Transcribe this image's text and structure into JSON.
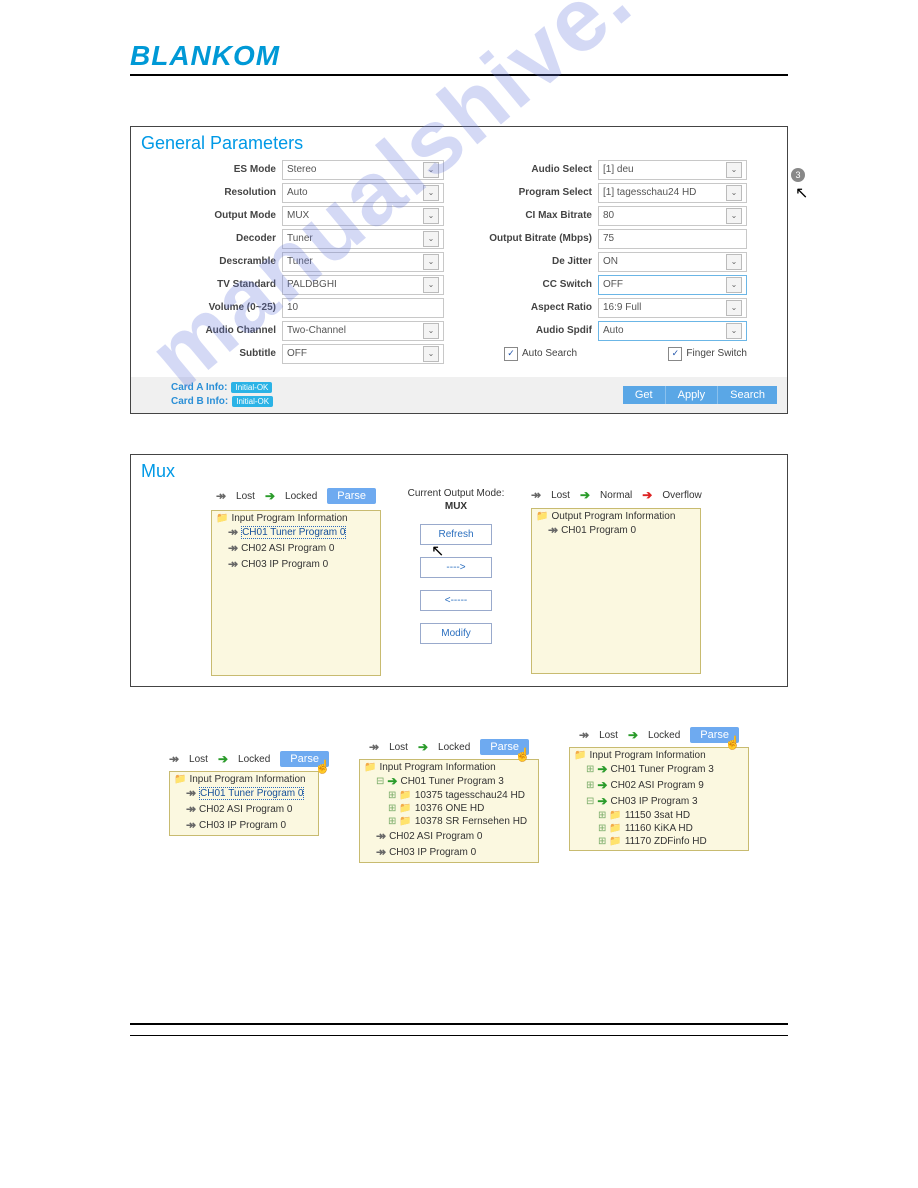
{
  "logo": "BLANKOM",
  "watermark": "manualshive.com",
  "general": {
    "title": "General Parameters",
    "left": {
      "es_mode": {
        "label": "ES Mode",
        "value": "Stereo"
      },
      "resolution": {
        "label": "Resolution",
        "value": "Auto"
      },
      "output_mode": {
        "label": "Output Mode",
        "value": "MUX"
      },
      "decoder": {
        "label": "Decoder",
        "value": "Tuner"
      },
      "descramble": {
        "label": "Descramble",
        "value": "Tuner"
      },
      "tv_standard": {
        "label": "TV Standard",
        "value": "PALDBGHI"
      },
      "volume": {
        "label": "Volume (0~25)",
        "value": "10"
      },
      "audio_channel": {
        "label": "Audio Channel",
        "value": "Two-Channel"
      },
      "subtitle": {
        "label": "Subtitle",
        "value": "OFF"
      }
    },
    "right": {
      "audio_select": {
        "label": "Audio Select",
        "value": "[1] deu"
      },
      "program_select": {
        "label": "Program Select",
        "value": "[1] tagesschau24 HD"
      },
      "ci_max_bitrate": {
        "label": "CI Max Bitrate",
        "value": "80"
      },
      "output_bitrate": {
        "label": "Output Bitrate (Mbps)",
        "value": "75"
      },
      "de_jitter": {
        "label": "De Jitter",
        "value": "ON"
      },
      "cc_switch": {
        "label": "CC Switch",
        "value": "OFF"
      },
      "aspect_ratio": {
        "label": "Aspect Ratio",
        "value": "16:9 Full"
      },
      "audio_spdif": {
        "label": "Audio Spdif",
        "value": "Auto"
      },
      "auto_search": "Auto Search",
      "finger_switch": "Finger Switch"
    },
    "footer": {
      "card_a": "Card A Info:",
      "card_b": "Card B Info:",
      "badge": "Initial-OK",
      "get": "Get",
      "apply": "Apply",
      "search": "Search",
      "bubble": "3"
    }
  },
  "mux": {
    "title": "Mux",
    "legend": {
      "lost": "Lost",
      "locked": "Locked",
      "normal": "Normal",
      "overflow": "Overflow",
      "parse": "Parse"
    },
    "input_tree": {
      "title": "Input Program Information",
      "items": [
        "CH01 Tuner Program 0",
        "CH02 ASI Program 0",
        "CH03 IP Program 0"
      ]
    },
    "center": {
      "mode_label": "Current Output Mode:",
      "mode": "MUX",
      "refresh": "Refresh",
      "to_right": "---->",
      "to_left": "<-----",
      "modify": "Modify"
    },
    "output_tree": {
      "title": "Output Program Information",
      "items": [
        "CH01 Program 0"
      ]
    }
  },
  "bottom": {
    "t1": {
      "title": "Input Program Information",
      "items": [
        "CH01 Tuner Program 0",
        "CH02 ASI Program 0",
        "CH03 IP Program 0"
      ]
    },
    "t2": {
      "title": "Input Program Information",
      "ch01": "CH01 Tuner Program 3",
      "subs": [
        "10375 tagesschau24 HD",
        "10376 ONE HD",
        "10378 SR Fernsehen HD"
      ],
      "ch02": "CH02 ASI Program 0",
      "ch03": "CH03 IP Program 0"
    },
    "t3": {
      "title": "Input Program Information",
      "ch01": "CH01 Tuner Program 3",
      "ch02": "CH02 ASI Program 9",
      "ch03": "CH03 IP Program 3",
      "subs": [
        "11150 3sat HD",
        "11160 KiKA HD",
        "11170 ZDFinfo HD"
      ]
    }
  }
}
